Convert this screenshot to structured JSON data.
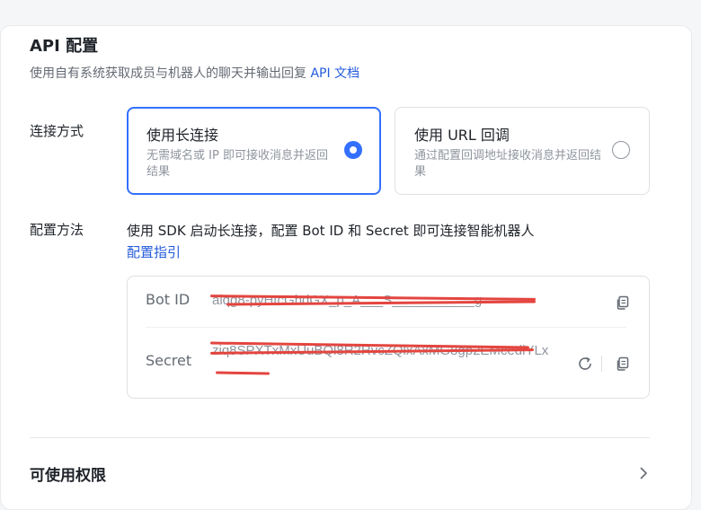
{
  "header": {
    "title": "API 配置",
    "desc_prefix": "使用自有系统获取成员与机器人的聊天并输出回复",
    "desc_link": "API 文档"
  },
  "connection": {
    "label": "连接方式",
    "options": [
      {
        "title": "使用长连接",
        "desc": "无需域名或 IP 即可接收消息并返回结果",
        "selected": true
      },
      {
        "title": "使用 URL 回调",
        "desc": "通过配置回调地址接收消息并返回结果",
        "selected": false
      }
    ]
  },
  "method": {
    "label": "配置方法",
    "text": "使用 SDK 启动长连接，配置 Bot ID 和 Secret 即可连接智能机器人",
    "link": "配置指引"
  },
  "credentials": {
    "bot_id_label": "Bot ID",
    "bot_id_value": "aiqg8-pyHtcGhdGX_p_A___S___________g",
    "secret_label": "Secret",
    "secret_value": "ziq8SPXTxMxUuBQl8R2RvcZQlxAxMG8gp2EMcedlYLx"
  },
  "permissions": {
    "title": "可使用权限"
  },
  "colors": {
    "accent": "#3370ff",
    "link": "#245bdb",
    "redaction": "#e4453f"
  },
  "icons": [
    "copy-icon",
    "refresh-icon",
    "chevron-right-icon"
  ]
}
